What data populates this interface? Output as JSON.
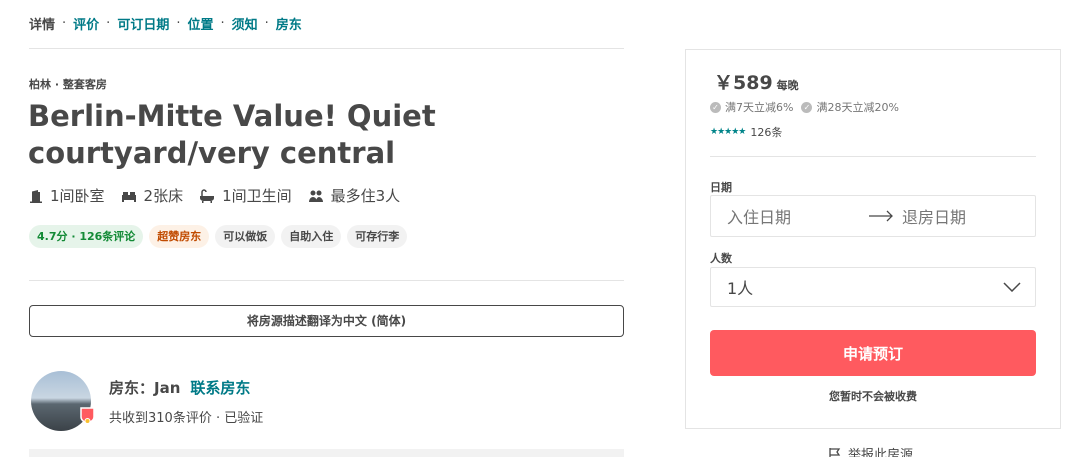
{
  "nav": {
    "items": [
      {
        "label": "详情",
        "active": true
      },
      {
        "label": "评价",
        "active": false
      },
      {
        "label": "可订日期",
        "active": false
      },
      {
        "label": "位置",
        "active": false
      },
      {
        "label": "须知",
        "active": false
      },
      {
        "label": "房东",
        "active": false
      }
    ],
    "separator": "·"
  },
  "listing": {
    "breadcrumb": "柏林 · 整套客房",
    "title": "Berlin-Mitte Value! Quiet courtyard/very central",
    "amenities": [
      {
        "icon": "door-icon",
        "label": "1间卧室"
      },
      {
        "icon": "bed-icon",
        "label": "2张床"
      },
      {
        "icon": "bathtub-icon",
        "label": "1间卫生间"
      },
      {
        "icon": "guests-icon",
        "label": "最多住3人"
      }
    ],
    "tags": [
      {
        "label": "4.7分 · 126条评论",
        "style": "green"
      },
      {
        "label": "超赞房东",
        "style": "orange"
      },
      {
        "label": "可以做饭",
        "style": "gray"
      },
      {
        "label": "自助入住",
        "style": "gray"
      },
      {
        "label": "可存行李",
        "style": "gray"
      }
    ],
    "translate_label": "将房源描述翻译为中文 (简体)"
  },
  "host": {
    "prefix": "房东：",
    "name": "Jan",
    "contact_label": "联系房东",
    "stats": "共收到310条评价 · 已验证"
  },
  "booking": {
    "price": "￥589",
    "per_night": "每晚",
    "discounts": [
      "满7天立减6%",
      "满28天立减20%"
    ],
    "stars": "★★★★★",
    "rating": 4.5,
    "review_count": "126条",
    "dates_label": "日期",
    "checkin_placeholder": "入住日期",
    "checkout_placeholder": "退房日期",
    "guests_label": "人数",
    "guests_value": "1人",
    "book_label": "申请预订",
    "no_charge": "您暂时不会被收费",
    "report_label": "举报此房源"
  },
  "colors": {
    "teal": "#007a87",
    "accent": "#ff5a5f",
    "text": "#484848",
    "green_tag": "#138a36",
    "orange_tag": "#c14b00"
  }
}
